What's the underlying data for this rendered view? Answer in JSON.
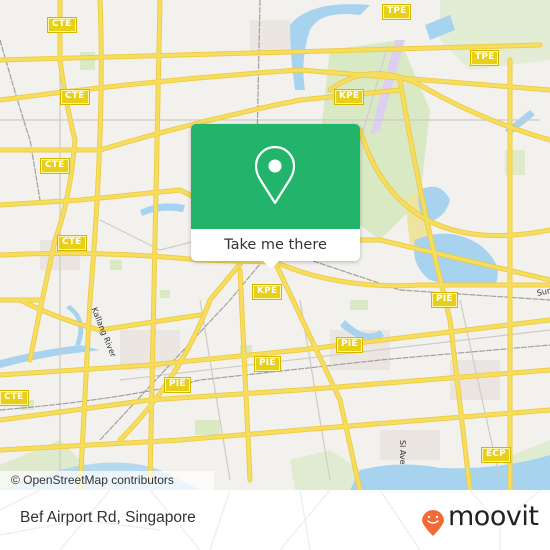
{
  "map": {
    "colors": {
      "land": "#f2f1ed",
      "road": "#f7dc5a",
      "road_casing": "#eac94a",
      "water": "#a8d3ef",
      "park": "#d6e8c0",
      "rail": "#999999",
      "runway": "#e0d2f0",
      "shield": "#e8cf18"
    },
    "highway_shields": [
      {
        "id": "cte-1",
        "label": "CTE"
      },
      {
        "id": "cte-2",
        "label": "CTE"
      },
      {
        "id": "cte-3",
        "label": "CTE"
      },
      {
        "id": "cte-4",
        "label": "CTE"
      },
      {
        "id": "cte-5",
        "label": "CTE"
      },
      {
        "id": "cte-6",
        "label": "CTE"
      },
      {
        "id": "tpe-1",
        "label": "TPE"
      },
      {
        "id": "tpe-2",
        "label": "TPE"
      },
      {
        "id": "kpe-1",
        "label": "KPE"
      },
      {
        "id": "kpe-2",
        "label": "KPE"
      },
      {
        "id": "pie-1",
        "label": "PIE"
      },
      {
        "id": "pie-2",
        "label": "PIE"
      },
      {
        "id": "pie-3",
        "label": "PIE"
      },
      {
        "id": "pie-4",
        "label": "PIE"
      },
      {
        "id": "ecp-1",
        "label": "ECP"
      }
    ],
    "street_labels": {
      "kallang_river": "Kallang River",
      "sims_ave": "Si Ave",
      "sungei": "Sun"
    },
    "attribution": "© OpenStreetMap contributors"
  },
  "popup": {
    "icon": "map-pin-icon",
    "background": "#21b46a",
    "cta_label": "Take me there"
  },
  "footer": {
    "address": "Bef Airport Rd, Singapore",
    "brand": {
      "name": "moovit",
      "icon": "moovit-smiley-pin-icon",
      "color": "#f26a35"
    }
  }
}
